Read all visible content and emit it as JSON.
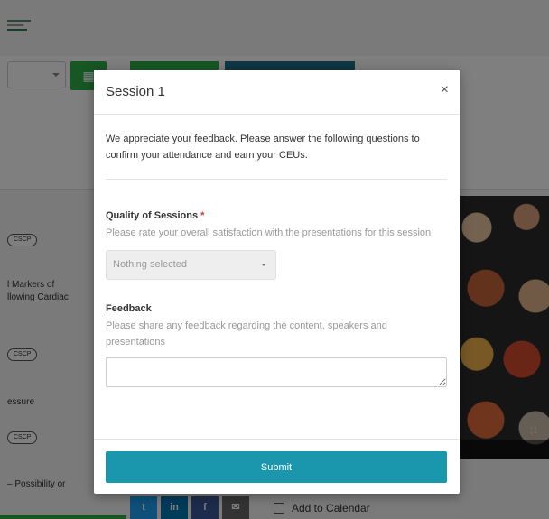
{
  "background": {
    "tags": [
      "CSCP",
      "CSCP",
      "CSCP"
    ],
    "list_texts": [
      "l Markers of",
      "llowing Cardiac",
      "essure",
      "– Possibility or"
    ],
    "share_labels": [
      "t",
      "in",
      "f",
      "✉"
    ],
    "add_to_calendar": "Add to Calendar"
  },
  "modal": {
    "title": "Session 1",
    "close_label": "×",
    "intro": "We appreciate your feedback. Please answer the following questions to confirm your attendance and earn your CEUs.",
    "question1": {
      "label": "Quality of Sessions",
      "required_mark": "*",
      "help": "Please rate your overall satisfaction with the presentations for this session",
      "selected": "Nothing selected"
    },
    "question2": {
      "label": "Feedback",
      "help": "Please share any feedback regarding the content, speakers and presentations",
      "value": ""
    },
    "submit_label": "Submit"
  },
  "colors": {
    "submit": "#1a97ad",
    "required": "#e2342e",
    "green": "#2eae49",
    "teal": "#1d6f8a"
  }
}
